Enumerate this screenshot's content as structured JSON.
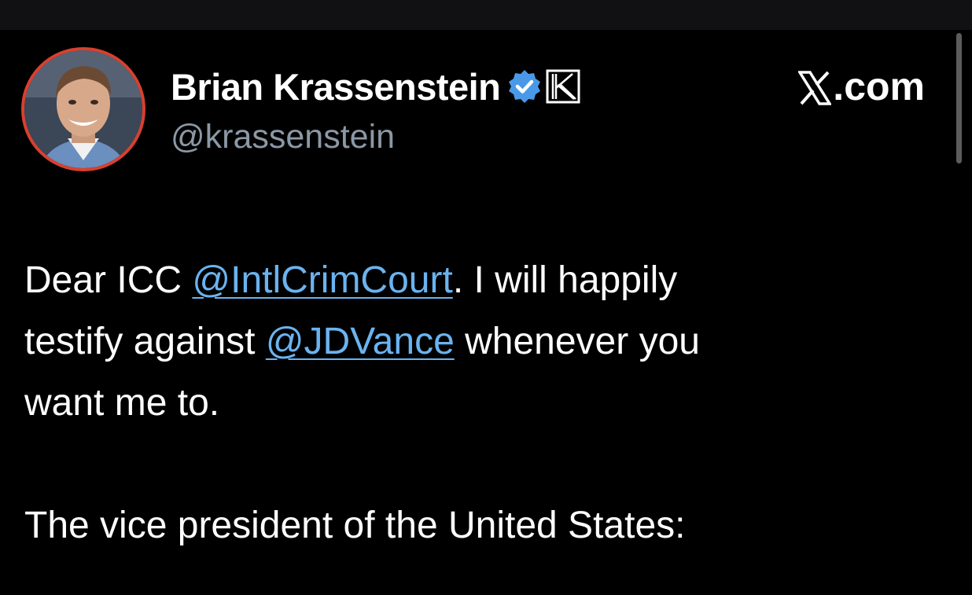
{
  "author": {
    "display_name": "Brian Krassenstein",
    "handle": "@krassenstein",
    "verified": true,
    "badge_icon": "k-badge-icon",
    "avatar_icon": "avatar"
  },
  "site": {
    "label": ".com",
    "logo_icon": "x-logo-icon"
  },
  "tweet": {
    "line1_prefix": "Dear ICC ",
    "mention_1": "@IntlCrimCourt",
    "line1_suffix": ". I will happily",
    "line2_prefix": "testify against ",
    "mention_2": "@JDVance",
    "line2_suffix": " whenever you",
    "line3": "want me to.",
    "paragraph_2": "The vice president of the United States:"
  },
  "colors": {
    "background": "#000000",
    "link": "#6ab3f0",
    "verified": "#4a99e9",
    "avatar_ring": "#d8402f",
    "handle": "#8b98a5"
  }
}
